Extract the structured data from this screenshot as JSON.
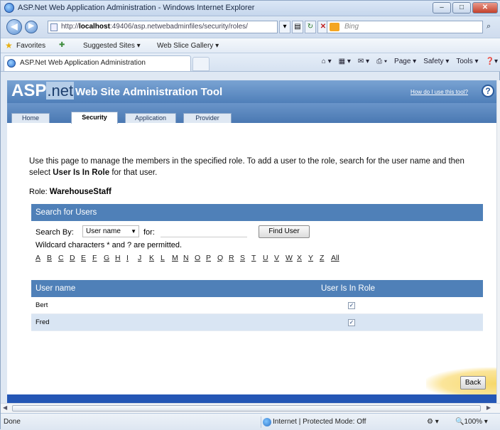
{
  "window": {
    "title": "ASP.Net Web Application Administration - Windows Internet Explorer",
    "min_glyph": "–",
    "max_glyph": "□",
    "close_glyph": "✕"
  },
  "address_bar": {
    "url_prefix": "http://",
    "url_host": "localhost",
    "url_rest": ":49406/asp.netwebadminfiles/security/roles/",
    "search_placeholder": "Bing"
  },
  "favorites_bar": {
    "favorites": "Favorites",
    "suggested": "Suggested Sites ▾",
    "gallery": "Web Slice Gallery ▾"
  },
  "browser_tab": {
    "label": "ASP.Net Web Application Administration"
  },
  "command_bar": {
    "page": "Page ▾",
    "safety": "Safety ▾",
    "tools": "Tools ▾"
  },
  "admin": {
    "logo_asp": "ASP",
    "logo_net": ".net",
    "tool_title": "Web Site Administration Tool",
    "help_link": "How do I use this tool?",
    "help_glyph": "?",
    "tabs": [
      {
        "label": "Home"
      },
      {
        "label": "Security"
      },
      {
        "label": "Application"
      },
      {
        "label": "Provider"
      }
    ],
    "active_tab": "Security"
  },
  "page": {
    "description_part1": "Use this page to manage the members in the specified role. To add a user to the role, search for the user name and then select ",
    "description_bold": "User Is In Role",
    "description_part2": " for that user.",
    "role_label": "Role: ",
    "role_name": "WarehouseStaff"
  },
  "search": {
    "header": "Search for Users",
    "search_by_label": "Search By:",
    "search_by_value": "User name",
    "for_label": "for:",
    "input_value": "",
    "find_button": "Find User",
    "wildcard_note": "Wildcard characters * and ? are permitted.",
    "letters": [
      "A",
      "B",
      "C",
      "D",
      "E",
      "F",
      "G",
      "H",
      "I",
      "J",
      "K",
      "L",
      "M",
      "N",
      "O",
      "P",
      "Q",
      "R",
      "S",
      "T",
      "U",
      "V",
      "W",
      "X",
      "Y",
      "Z",
      "All"
    ]
  },
  "grid": {
    "columns": [
      "User name",
      "User Is In Role"
    ],
    "rows": [
      {
        "user": "Bert",
        "in_role": true
      },
      {
        "user": "Fred",
        "in_role": true
      }
    ]
  },
  "back_button": "Back",
  "status_bar": {
    "status": "Done",
    "zone": "Internet | Protected Mode: Off",
    "zoom": "100%"
  }
}
